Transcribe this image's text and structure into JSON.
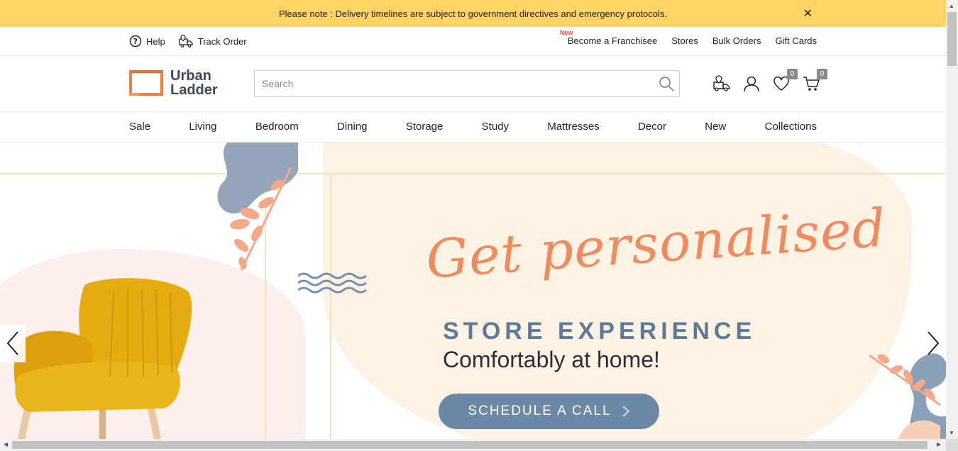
{
  "notice": {
    "text": "Please note : Delivery timelines are subject to government directives and emergency protocols.",
    "close_label": "✕"
  },
  "utility": {
    "help": "Help",
    "track_order": "Track Order",
    "new_tag": "New",
    "franchisee": "Become a Franchisee",
    "stores": "Stores",
    "bulk_orders": "Bulk Orders",
    "gift_cards": "Gift Cards"
  },
  "header": {
    "logo_line1": "Urban",
    "logo_line2": "Ladder",
    "search_placeholder": "Search",
    "wishlist_count": "0",
    "cart_count": "0"
  },
  "nav": {
    "items": [
      "Sale",
      "Living",
      "Bedroom",
      "Dining",
      "Storage",
      "Study",
      "Mattresses",
      "Decor",
      "New",
      "Collections"
    ]
  },
  "hero": {
    "headline": "Get personalised",
    "subheading": "STORE EXPERIENCE",
    "tagline": "Comfortably at home!",
    "cta": "SCHEDULE A CALL"
  },
  "colors": {
    "notice_bg": "#ffd466",
    "accent_orange": "#f08b60",
    "cta_blue": "#6b89a7",
    "chair_yellow": "#e6b012"
  },
  "icons": [
    "help-icon",
    "track-order-icon",
    "search-icon",
    "store-locator-icon",
    "user-icon",
    "heart-icon",
    "cart-icon",
    "chevron-left-icon",
    "chevron-right-icon"
  ]
}
